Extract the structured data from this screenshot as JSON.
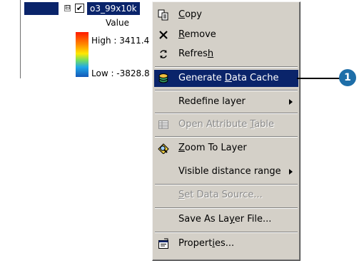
{
  "toc": {
    "layer_name": "o3_99x10k",
    "expander": "⊟",
    "checkbox": "✔",
    "legend_heading": "Value",
    "high_label": "High : 3411.4",
    "low_label": "Low : -3828.8"
  },
  "menu": {
    "items": [
      {
        "label_pre": "",
        "accel": "C",
        "label_post": "opy",
        "icon": "copy-icon"
      },
      {
        "label_pre": "",
        "accel": "R",
        "label_post": "emove",
        "icon": "remove-x-icon"
      },
      {
        "label_pre": "Refres",
        "accel": "h",
        "label_post": "",
        "icon": "refresh-icon"
      },
      {
        "label_pre": "Generate ",
        "accel": "D",
        "label_post": "ata Cache",
        "icon": "data-cache-icon",
        "highlighted": true
      },
      {
        "label_pre": "Redefine layer",
        "accel": "",
        "label_post": "",
        "submenu": true
      },
      {
        "label_pre": "Open Attribute ",
        "accel": "T",
        "label_post": "able",
        "icon": "table-icon",
        "disabled": true
      },
      {
        "label_pre": "",
        "accel": "Z",
        "label_post": "oom To Layer",
        "icon": "zoom-to-layer-icon"
      },
      {
        "label_pre": "Visible distance range",
        "accel": "",
        "label_post": "",
        "submenu": true
      },
      {
        "label_pre": "",
        "accel": "S",
        "label_post": "et Data Source...",
        "disabled": true
      },
      {
        "label_pre": "Save As La",
        "accel": "y",
        "label_post": "er File..."
      },
      {
        "label_pre": "Propert",
        "accel": "i",
        "label_post": "es...",
        "icon": "properties-icon"
      }
    ]
  },
  "callout": {
    "number": "1"
  },
  "colors": {
    "highlight": "#0a246a",
    "menu_bg": "#d4d0c8",
    "callout": "#1e6ea8"
  }
}
